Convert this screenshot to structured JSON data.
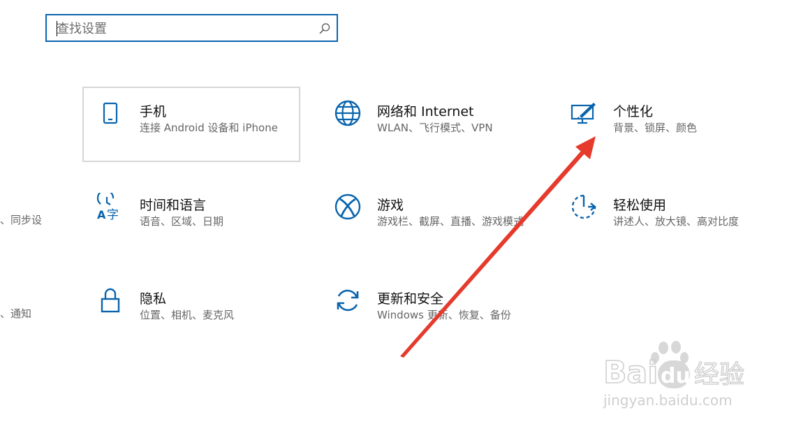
{
  "search": {
    "placeholder": "查找设置"
  },
  "tiles": [
    {
      "id": "phone",
      "title": "手机",
      "desc": "连接 Android 设备和 iPhone",
      "icon": "phone-icon"
    },
    {
      "id": "network",
      "title": "网络和 Internet",
      "desc": "WLAN、飞行模式、VPN",
      "icon": "globe-icon"
    },
    {
      "id": "personalization",
      "title": "个性化",
      "desc": "背景、锁屏、颜色",
      "icon": "personalization-icon"
    },
    {
      "id": "time-language",
      "title": "时间和语言",
      "desc": "语音、区域、日期",
      "icon": "time-language-icon"
    },
    {
      "id": "gaming",
      "title": "游戏",
      "desc": "游戏栏、截屏、直播、游戏模式",
      "icon": "xbox-icon"
    },
    {
      "id": "ease-of-access",
      "title": "轻松使用",
      "desc": "讲述人、放大镜、高对比度",
      "icon": "ease-of-access-icon"
    },
    {
      "id": "privacy",
      "title": "隐私",
      "desc": "位置、相机、麦克风",
      "icon": "lock-icon"
    },
    {
      "id": "update-security",
      "title": "更新和安全",
      "desc": "Windows 更新、恢复、备份",
      "icon": "update-icon"
    }
  ],
  "partials": [
    {
      "text": "、同步设"
    },
    {
      "text": "、通知"
    }
  ],
  "accent_color": "#0a64ad",
  "annotation_color": "#e53a2c",
  "watermark": {
    "brand": "Baidu经验",
    "url": "jingyan.baidu.com"
  }
}
